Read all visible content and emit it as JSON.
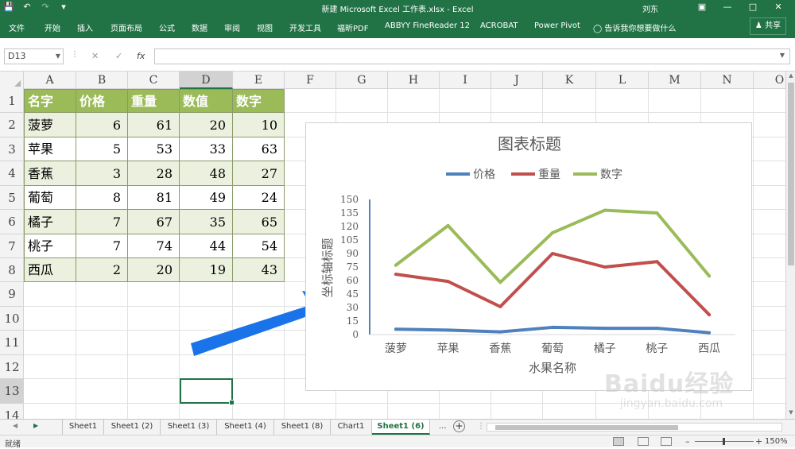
{
  "titlebar": {
    "document_title": "新建 Microsoft Excel 工作表.xlsx  -  Excel",
    "user": "刘东"
  },
  "ribbon": {
    "tabs": [
      "文件",
      "开始",
      "插入",
      "页面布局",
      "公式",
      "数据",
      "审阅",
      "视图",
      "开发工具",
      "福昕PDF",
      "ABBYY FineReader 12",
      "ACROBAT",
      "Power Pivot"
    ],
    "tell_me": "告诉我你想要做什么",
    "share": "共享"
  },
  "formula_bar": {
    "name_box": "D13",
    "fx": "fx",
    "value": ""
  },
  "columns": [
    "A",
    "B",
    "C",
    "D",
    "E",
    "F",
    "G",
    "H",
    "I",
    "J",
    "K",
    "L",
    "M",
    "N",
    "O"
  ],
  "rows": [
    "1",
    "2",
    "3",
    "4",
    "5",
    "6",
    "7",
    "8",
    "9",
    "10",
    "11",
    "12",
    "13",
    "14"
  ],
  "table": {
    "headers": [
      "名字",
      "价格",
      "重量",
      "数值",
      "数字"
    ],
    "rows": [
      [
        "菠萝",
        "6",
        "61",
        "20",
        "10"
      ],
      [
        "苹果",
        "5",
        "53",
        "33",
        "63"
      ],
      [
        "香蕉",
        "3",
        "28",
        "48",
        "27"
      ],
      [
        "葡萄",
        "8",
        "81",
        "49",
        "24"
      ],
      [
        "橘子",
        "7",
        "67",
        "35",
        "65"
      ],
      [
        "桃子",
        "7",
        "74",
        "44",
        "54"
      ],
      [
        "西瓜",
        "2",
        "20",
        "19",
        "43"
      ]
    ]
  },
  "chart_data": {
    "type": "line",
    "title": "图表标题",
    "xlabel": "水果名称",
    "ylabel": "坐标轴标题",
    "categories": [
      "菠萝",
      "苹果",
      "香蕉",
      "葡萄",
      "橘子",
      "桃子",
      "西瓜"
    ],
    "ylim": [
      0,
      150
    ],
    "yticks": [
      "0",
      "15",
      "30",
      "45",
      "60",
      "75",
      "90",
      "105",
      "120",
      "135",
      "150"
    ],
    "legend_position": "top",
    "grid": false,
    "series": [
      {
        "name": "价格",
        "color": "#4f81bd",
        "values": [
          6,
          5,
          3,
          8,
          7,
          7,
          2
        ]
      },
      {
        "name": "重量",
        "color": "#c0504d",
        "values": [
          67,
          59,
          31,
          90,
          75,
          81,
          22
        ]
      },
      {
        "name": "数字",
        "color": "#9bbb59",
        "values": [
          77,
          121,
          58,
          113,
          138,
          135,
          65
        ]
      }
    ]
  },
  "sheet_tabs": [
    "Sheet1",
    "Sheet1 (2)",
    "Sheet1 (3)",
    "Sheet1 (4)",
    "Sheet1 (8)",
    "Chart1",
    "Sheet1 (6)"
  ],
  "active_sheet": "Sheet1 (6)",
  "more_tabs": "...",
  "status": {
    "ready": "就绪",
    "zoom": "150%"
  },
  "watermark": {
    "logo": "Baidu经验",
    "url": "jingyan.baidu.com"
  },
  "colors": {
    "excel_green": "#217346",
    "header_fill": "#9bbb59",
    "band_fill": "#ebf1de",
    "arrow": "#1a73e8"
  }
}
